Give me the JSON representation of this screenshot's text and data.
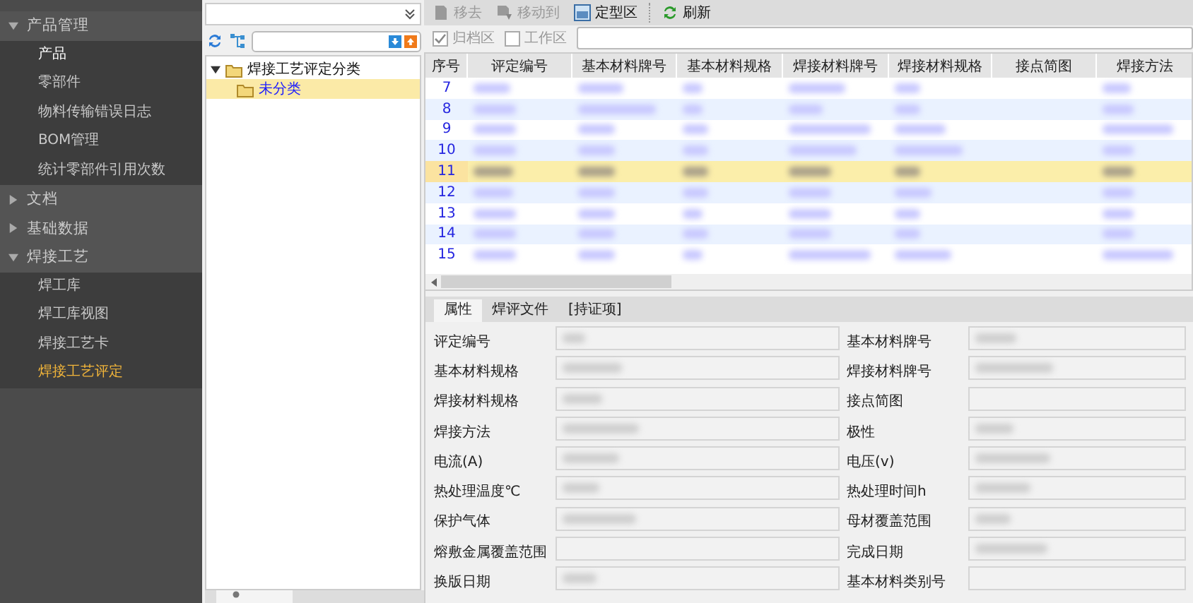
{
  "sidebar": {
    "groups": [
      {
        "label": "产品管理",
        "expanded": true,
        "items": [
          {
            "label": "产品",
            "selected": false,
            "hovered": true
          },
          {
            "label": "零部件",
            "selected": false,
            "hovered": false
          },
          {
            "label": "物料传输错误日志",
            "selected": false,
            "hovered": false
          },
          {
            "label": "BOM管理",
            "selected": false,
            "hovered": false
          },
          {
            "label": "统计零部件引用次数",
            "selected": false,
            "hovered": false
          }
        ]
      },
      {
        "label": "文档",
        "expanded": false
      },
      {
        "label": "基础数据",
        "expanded": false
      },
      {
        "label": "焊接工艺",
        "expanded": true,
        "items": [
          {
            "label": "焊工库",
            "selected": false,
            "hovered": false
          },
          {
            "label": "焊工库视图",
            "selected": false,
            "hovered": false
          },
          {
            "label": "焊接工艺卡",
            "selected": false,
            "hovered": false
          },
          {
            "label": "焊接工艺评定",
            "selected": true,
            "hovered": false
          }
        ]
      }
    ]
  },
  "tree": {
    "nodes": [
      {
        "label": "焊接工艺评定分类",
        "expanded": true,
        "selected": false,
        "children": [
          {
            "label": "未分类",
            "selected": false,
            "current": true
          }
        ]
      }
    ]
  },
  "toolbar": {
    "buttons": [
      {
        "label": "移去",
        "kind": "remove",
        "disabled": true
      },
      {
        "label": "移动到",
        "kind": "move",
        "disabled": true
      },
      {
        "label": "定型区",
        "kind": "final",
        "disabled": false
      },
      {
        "label": "刷新",
        "kind": "refresh",
        "disabled": false
      }
    ]
  },
  "filters": [
    {
      "label": "归档区",
      "checked": true
    },
    {
      "label": "工作区",
      "checked": false
    }
  ],
  "table": {
    "columns": [
      {
        "label": "序号"
      },
      {
        "label": "评定编号",
        "redacted": true
      },
      {
        "label": "基本材料牌号",
        "redacted": true
      },
      {
        "label": "基本材料规格",
        "redacted": true
      },
      {
        "label": "焊接材料牌号",
        "redacted": true
      },
      {
        "label": "焊接材料规格",
        "redacted": true
      },
      {
        "label": "接点简图",
        "redacted": false
      },
      {
        "label": "焊接方法",
        "redacted": true
      }
    ],
    "rows": [
      {
        "number": "7",
        "selected": false
      },
      {
        "number": "8",
        "selected": false
      },
      {
        "number": "9",
        "selected": false
      },
      {
        "number": "10",
        "selected": false
      },
      {
        "number": "11",
        "selected": true
      },
      {
        "number": "12",
        "selected": false
      },
      {
        "number": "13",
        "selected": false
      },
      {
        "number": "14",
        "selected": false
      },
      {
        "number": "15",
        "selected": false
      }
    ]
  },
  "detail_tabs": [
    {
      "label": "属性",
      "selected": true
    },
    {
      "label": "焊评文件",
      "selected": false
    },
    {
      "label": "[持证项]",
      "selected": false
    }
  ],
  "properties": [
    {
      "label": "评定编号",
      "redacted": true
    },
    {
      "label": "基本材料牌号",
      "redacted": true
    },
    {
      "label": "基本材料规格",
      "redacted": true
    },
    {
      "label": "焊接材料牌号",
      "redacted": true
    },
    {
      "label": "焊接材料规格",
      "redacted": true
    },
    {
      "label": "接点简图",
      "redacted": false
    },
    {
      "label": "焊接方法",
      "redacted": true
    },
    {
      "label": "极性",
      "redacted": true
    },
    {
      "label": "电流(A)",
      "redacted": true
    },
    {
      "label": "电压(v)",
      "redacted": true
    },
    {
      "label": "热处理温度℃",
      "redacted": true
    },
    {
      "label": "热处理时间h",
      "redacted": true
    },
    {
      "label": "保护气体",
      "redacted": true
    },
    {
      "label": "母材覆盖范围",
      "redacted": true
    },
    {
      "label": "熔敷金属覆盖范围",
      "redacted": false
    },
    {
      "label": "完成日期",
      "redacted": true
    },
    {
      "label": "换版日期",
      "redacted": true
    },
    {
      "label": "基本材料类别号",
      "redacted": false
    }
  ]
}
